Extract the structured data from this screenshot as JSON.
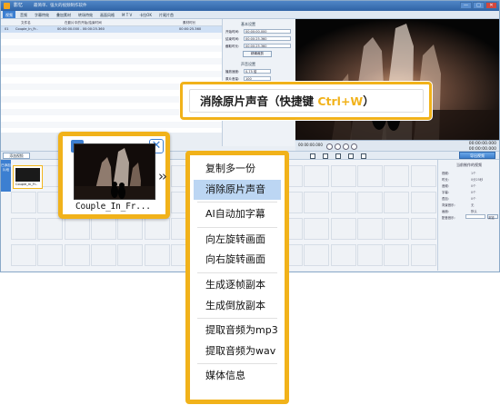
{
  "app": {
    "title": "影忆",
    "subtitle": "最简单、强大的视频制作软件",
    "window_buttons": [
      "—",
      "□",
      "✕"
    ]
  },
  "menu": [
    "视频",
    "音频",
    "字幕特效",
    "叠加素材",
    "转场特效",
    "画面风格",
    "M T V",
    "卡拉OK",
    "片尾片首"
  ],
  "list": {
    "headers": [
      "文件名",
      "在影片中的开始/结束时间",
      "素材时长"
    ],
    "row": {
      "index": "01",
      "name": "Couple_In_Fr..",
      "time": "00:00:00.000 - 00:00:25.360",
      "duration": "00:00:25.360"
    }
  },
  "props": {
    "section1": "基本设置",
    "start_label": "开始时间:",
    "start_value": "00:00:00.000",
    "end_label": "结束时间:",
    "end_value": "00:00:25.360",
    "duration_label": "截取时长:",
    "duration_value": "00:00:25.360",
    "trim_button": "精确裁剪",
    "section2": "声音设置",
    "speed_label": "播放速度:",
    "speed_value": "0.75 倍",
    "volume_label": "原片音量:",
    "volume_value": "100",
    "checkbox_label": "加速时音调不变"
  },
  "player": {
    "timecode": "00:00:00.000",
    "time_right_top": "00:00:00.000",
    "time_right_bottom": "00:00:00.000"
  },
  "timeline": {
    "add_button": "添加视频",
    "export_button": "导出视频",
    "track_label": "已添加片段",
    "clip_name": "Couple_In_Fr.."
  },
  "right_panel": {
    "heading": "当前制作的视频",
    "rows": [
      {
        "label": "视频:",
        "value": "1个"
      },
      {
        "label": "时长:",
        "value": "0分25秒"
      },
      {
        "label": "音频:",
        "value": "0个"
      },
      {
        "label": "字幕:",
        "value": "0个"
      },
      {
        "label": "叠加:",
        "value": "0个"
      },
      {
        "label": "背景音乐:",
        "value": "无"
      },
      {
        "label": "画面:",
        "value": "默认"
      }
    ],
    "input_label": "配音音乐:",
    "button_label": "浏览"
  },
  "card": {
    "filename": "Couple_In_Fr..."
  },
  "context_menu": {
    "items": [
      "复制多一份",
      "消除原片声音",
      "AI自动加字幕",
      "向左旋转画面",
      "向右旋转画面",
      "生成逐帧副本",
      "生成倒放副本",
      "提取音频为mp3",
      "提取音频为wav",
      "媒体信息"
    ],
    "selected": "消除原片声音"
  },
  "callout": {
    "text": "消除原片声音（快捷键 ",
    "shortcut": "Ctrl+W",
    "close_paren": "）"
  },
  "colors": {
    "accent": "#f1b21a",
    "blue": "#3c7fd1",
    "selected": "#bcd6f3"
  }
}
